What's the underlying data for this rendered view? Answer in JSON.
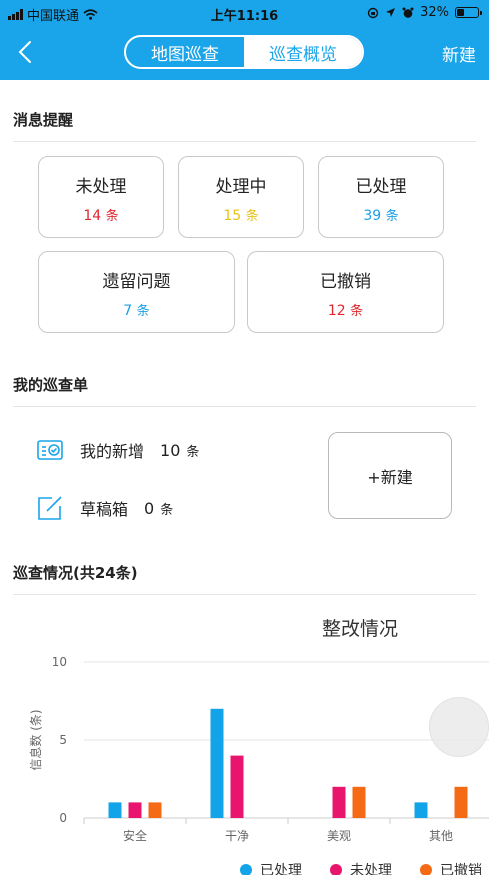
{
  "status_bar": {
    "carrier": "中国联通",
    "time": "上午11:16",
    "battery": "32%"
  },
  "header": {
    "tabs": [
      "地图巡查",
      "巡查概览"
    ],
    "active_tab": 1,
    "new_label": "新建"
  },
  "messages": {
    "title": "消息提醒",
    "unit": "条",
    "cards": [
      {
        "label": "未处理",
        "count": "14",
        "color": "#e0262e"
      },
      {
        "label": "处理中",
        "count": "15",
        "color": "#e8c21a"
      },
      {
        "label": "已处理",
        "count": "39",
        "color": "#1a9fe6"
      },
      {
        "label": "遗留问题",
        "count": "7",
        "color": "#1a9fe6"
      },
      {
        "label": "已撤销",
        "count": "12",
        "color": "#e0262e"
      }
    ]
  },
  "my_forms": {
    "title": "我的巡查单",
    "unit": "条",
    "items": [
      {
        "label": "我的新增",
        "count": "10",
        "icon": "form-check-icon"
      },
      {
        "label": "草稿箱",
        "count": "0",
        "icon": "edit-icon"
      }
    ],
    "new_button": "+新建"
  },
  "inspection": {
    "title": "巡查情况(共24条)"
  },
  "chart_data": {
    "type": "bar",
    "title": "整改情况",
    "ylabel": "信息数 (条)",
    "xlabel": "",
    "categories": [
      "安全",
      "干净",
      "美观",
      "其他"
    ],
    "ylim": [
      0,
      10
    ],
    "yticks": [
      0,
      5,
      10
    ],
    "grid": true,
    "legend_position": "bottom",
    "series": [
      {
        "name": "已处理",
        "color": "#12a4e8",
        "values": [
          1,
          7,
          0,
          1
        ]
      },
      {
        "name": "未处理",
        "color": "#e8146e",
        "values": [
          1,
          4,
          2,
          0
        ]
      },
      {
        "name": "已撤销",
        "color": "#f56a14",
        "values": [
          1,
          0,
          2,
          2
        ]
      }
    ]
  }
}
